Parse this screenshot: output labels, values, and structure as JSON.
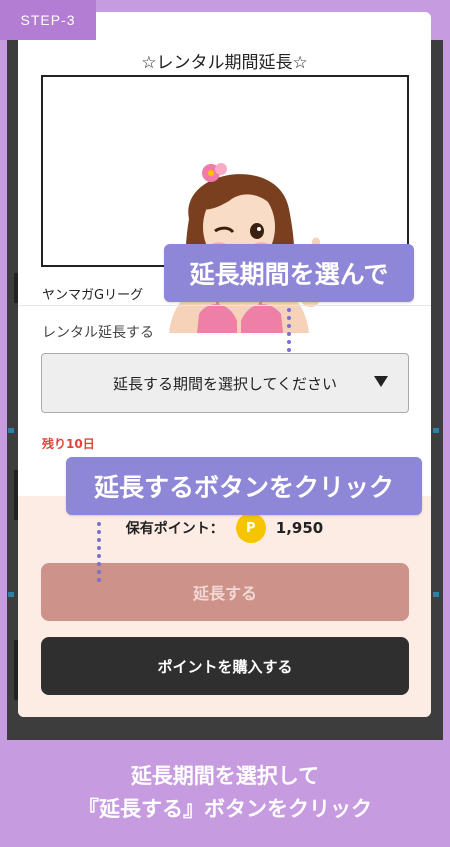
{
  "step_badge": "STEP-3",
  "modal": {
    "title": "☆レンタル期間延長☆",
    "magazine_name": "ヤンマガGリーグ",
    "section_label": "レンタル延長する",
    "select": {
      "value": "延長する期間を選択してください",
      "arrow_icon": "triangle-down-icon"
    },
    "remaining": "残り10日",
    "points_label": "保有ポイント：",
    "point_icon_letter": "P",
    "points_value": "1,950",
    "extend_button": "延長する",
    "buy_button": "ポイントを購入する"
  },
  "callouts": {
    "select_period": "延長期間を選んで",
    "click_extend": "延長するボタンをクリック"
  },
  "caption": {
    "line1": "延長期間を選択して",
    "line2": "『延長する』ボタンをクリック"
  },
  "colors": {
    "background": "#c79be0",
    "badge": "#b27dd2",
    "callout": "#8e86d6",
    "extend_button": "#cd938b",
    "buy_button": "#2f2f2f",
    "panel": "#fdece4",
    "remaining_text": "#e0453a",
    "coin": "#f7c500"
  }
}
